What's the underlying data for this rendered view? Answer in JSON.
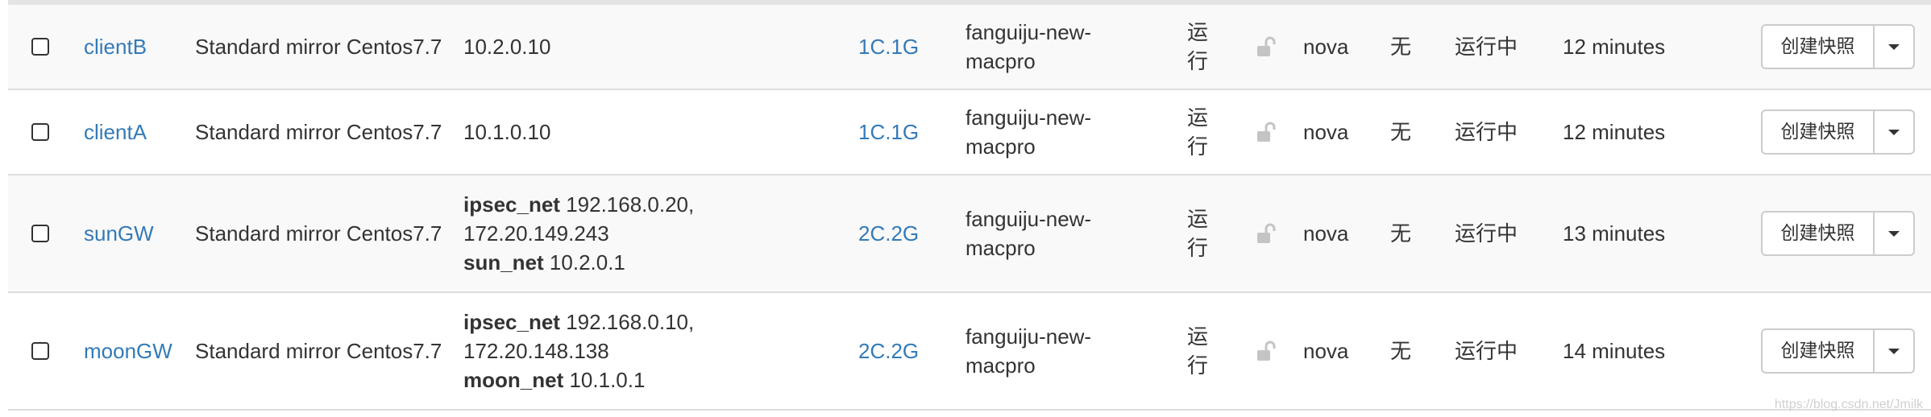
{
  "instances": [
    {
      "name": "clientB",
      "image": "Standard mirror Centos7.7",
      "ips": [
        {
          "net": "",
          "addr": "10.2.0.10"
        }
      ],
      "flavor": "1C.1G",
      "keypair": "fanguiju-new-macpro",
      "status": "运行",
      "az": "nova",
      "task": "无",
      "power": "运行中",
      "age": "12 minutes",
      "action": "创建快照"
    },
    {
      "name": "clientA",
      "image": "Standard mirror Centos7.7",
      "ips": [
        {
          "net": "",
          "addr": "10.1.0.10"
        }
      ],
      "flavor": "1C.1G",
      "keypair": "fanguiju-new-macpro",
      "status": "运行",
      "az": "nova",
      "task": "无",
      "power": "运行中",
      "age": "12 minutes",
      "action": "创建快照"
    },
    {
      "name": "sunGW",
      "image": "Standard mirror Centos7.7",
      "ips": [
        {
          "net": "ipsec_net",
          "addr": "192.168.0.20, 172.20.149.243"
        },
        {
          "net": "sun_net",
          "addr": "10.2.0.1"
        }
      ],
      "flavor": "2C.2G",
      "keypair": "fanguiju-new-macpro",
      "status": "运行",
      "az": "nova",
      "task": "无",
      "power": "运行中",
      "age": "13 minutes",
      "action": "创建快照"
    },
    {
      "name": "moonGW",
      "image": "Standard mirror Centos7.7",
      "ips": [
        {
          "net": "ipsec_net",
          "addr": "192.168.0.10, 172.20.148.138"
        },
        {
          "net": "moon_net",
          "addr": "10.1.0.1"
        }
      ],
      "flavor": "2C.2G",
      "keypair": "fanguiju-new-macpro",
      "status": "运行",
      "az": "nova",
      "task": "无",
      "power": "运行中",
      "age": "14 minutes",
      "action": "创建快照"
    }
  ],
  "watermark": "https://blog.csdn.net/Jmilk",
  "colors": {
    "link": "#337ab7",
    "row_stripe": "#f9f9f9",
    "border": "#dddddd",
    "text": "#333333"
  }
}
